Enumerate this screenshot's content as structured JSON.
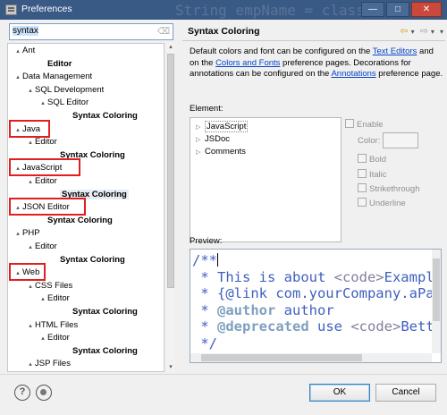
{
  "window": {
    "title": "Preferences",
    "bg_code": "String empName = classN",
    "buttons": [
      "—",
      "□",
      "✕"
    ]
  },
  "filter": {
    "value": "syntax",
    "clear_icon": "⌫"
  },
  "tree": [
    {
      "label": "Ant",
      "depth": 0,
      "toggle": "▴",
      "bold": false
    },
    {
      "label": "Editor",
      "depth": 2,
      "toggle": "",
      "bold": true
    },
    {
      "label": "Data Management",
      "depth": 0,
      "toggle": "▴",
      "bold": false
    },
    {
      "label": "SQL Development",
      "depth": 1,
      "toggle": "▴",
      "bold": false
    },
    {
      "label": "SQL Editor",
      "depth": 2,
      "toggle": "▴",
      "bold": false
    },
    {
      "label": "Syntax Coloring",
      "depth": 4,
      "toggle": "",
      "bold": true
    },
    {
      "label": "Java",
      "depth": 0,
      "toggle": "▴",
      "bold": false,
      "boxed": true
    },
    {
      "label": "Editor",
      "depth": 1,
      "toggle": "▴",
      "bold": false
    },
    {
      "label": "Syntax Coloring",
      "depth": 3,
      "toggle": "",
      "bold": true
    },
    {
      "label": "JavaScript",
      "depth": 0,
      "toggle": "▴",
      "bold": false,
      "boxed": true
    },
    {
      "label": "Editor",
      "depth": 1,
      "toggle": "▴",
      "bold": false
    },
    {
      "label": "Syntax Coloring",
      "depth": 3,
      "toggle": "",
      "bold": true,
      "selected": true
    },
    {
      "label": "JSON Editor",
      "depth": 0,
      "toggle": "▴",
      "bold": false,
      "boxed": true
    },
    {
      "label": "Syntax Coloring",
      "depth": 2,
      "toggle": "",
      "bold": true
    },
    {
      "label": "PHP",
      "depth": 0,
      "toggle": "▴",
      "bold": false
    },
    {
      "label": "Editor",
      "depth": 1,
      "toggle": "▴",
      "bold": false
    },
    {
      "label": "Syntax Coloring",
      "depth": 3,
      "toggle": "",
      "bold": true
    },
    {
      "label": "Web",
      "depth": 0,
      "toggle": "▴",
      "bold": false,
      "boxed": true
    },
    {
      "label": "CSS Files",
      "depth": 1,
      "toggle": "▴",
      "bold": false
    },
    {
      "label": "Editor",
      "depth": 2,
      "toggle": "▴",
      "bold": false
    },
    {
      "label": "Syntax Coloring",
      "depth": 4,
      "toggle": "",
      "bold": true
    },
    {
      "label": "HTML Files",
      "depth": 1,
      "toggle": "▴",
      "bold": false
    },
    {
      "label": "Editor",
      "depth": 2,
      "toggle": "▴",
      "bold": false
    },
    {
      "label": "Syntax Coloring",
      "depth": 4,
      "toggle": "",
      "bold": true
    },
    {
      "label": "JSP Files",
      "depth": 1,
      "toggle": "▴",
      "bold": false
    }
  ],
  "page": {
    "title": "Syntax Coloring",
    "nav": {
      "back": "⇦",
      "back_menu": "▾",
      "forward": "⇨",
      "forward_menu": "▾",
      "view_menu": "▾"
    },
    "description": {
      "p1": "Default colors and font can be configured on the ",
      "link1": "Text Editors",
      "p2": " and on the ",
      "link2": "Colors and Fonts",
      "p3": " preference pages.  Decorations for annotations can be configured on the ",
      "link3": "Annotations",
      "p4": " preference page."
    },
    "element_label": "Element:",
    "elements": [
      {
        "label": "JavaScript",
        "toggle": "▷",
        "selected": true
      },
      {
        "label": "JSDoc",
        "toggle": "▷",
        "selected": false
      },
      {
        "label": "Comments",
        "toggle": "▷",
        "selected": false
      }
    ],
    "options": {
      "enable": "Enable",
      "color": "Color:",
      "bold": "Bold",
      "italic": "Italic",
      "strikethrough": "Strikethrough",
      "underline": "Underline"
    },
    "preview_label": "Preview:",
    "preview_lines": [
      "/**",
      " * This is about <code>Example",
      " * {@link com.yourCompany.aPa",
      " * @author author",
      " * @deprecated use <code>Better",
      " */"
    ]
  },
  "bottom": {
    "help_icon": "?",
    "ok": "OK",
    "cancel": "Cancel"
  },
  "colors": {
    "title_bar": "#3a5a86",
    "highlight_box": "#e02020",
    "link": "#0645c8",
    "javadoc": "#3f5fbf"
  }
}
